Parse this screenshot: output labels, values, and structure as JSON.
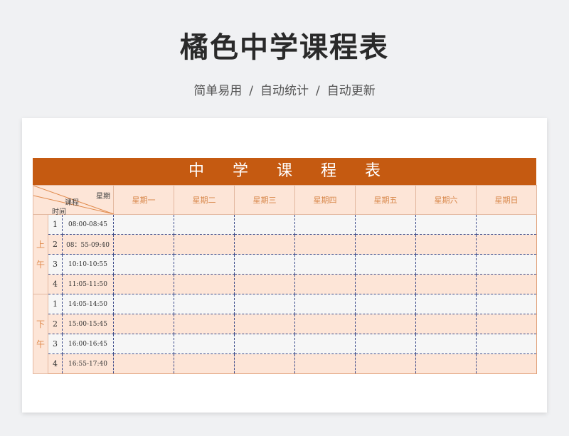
{
  "page": {
    "title": "橘色中学课程表",
    "features": [
      "简单易用",
      "自动统计",
      "自动更新"
    ],
    "separator": "/"
  },
  "sheet": {
    "banner": "中学课程表",
    "corner": {
      "weekday": "星期",
      "course": "课程",
      "time": "时间"
    },
    "days": [
      "星期一",
      "星期二",
      "星期三",
      "星期四",
      "星期五",
      "星期六",
      "星期日"
    ],
    "periods": [
      {
        "label": [
          "上",
          "午"
        ],
        "slots": [
          {
            "no": "1",
            "time": "08:00-08:45"
          },
          {
            "no": "2",
            "time": "08：55-09:40"
          },
          {
            "no": "3",
            "time": "10:10-10:55"
          },
          {
            "no": "4",
            "time": "11:05-11:50"
          }
        ]
      },
      {
        "label": [
          "下",
          "午"
        ],
        "slots": [
          {
            "no": "1",
            "time": "14:05-14:50"
          },
          {
            "no": "2",
            "time": "15:00-15:45"
          },
          {
            "no": "3",
            "time": "16:00-16:45"
          },
          {
            "no": "4",
            "time": "16:55-17:40"
          }
        ]
      }
    ]
  },
  "colors": {
    "accent": "#c55a11",
    "light": "#fde5d7",
    "dayText": "#d8874a"
  }
}
